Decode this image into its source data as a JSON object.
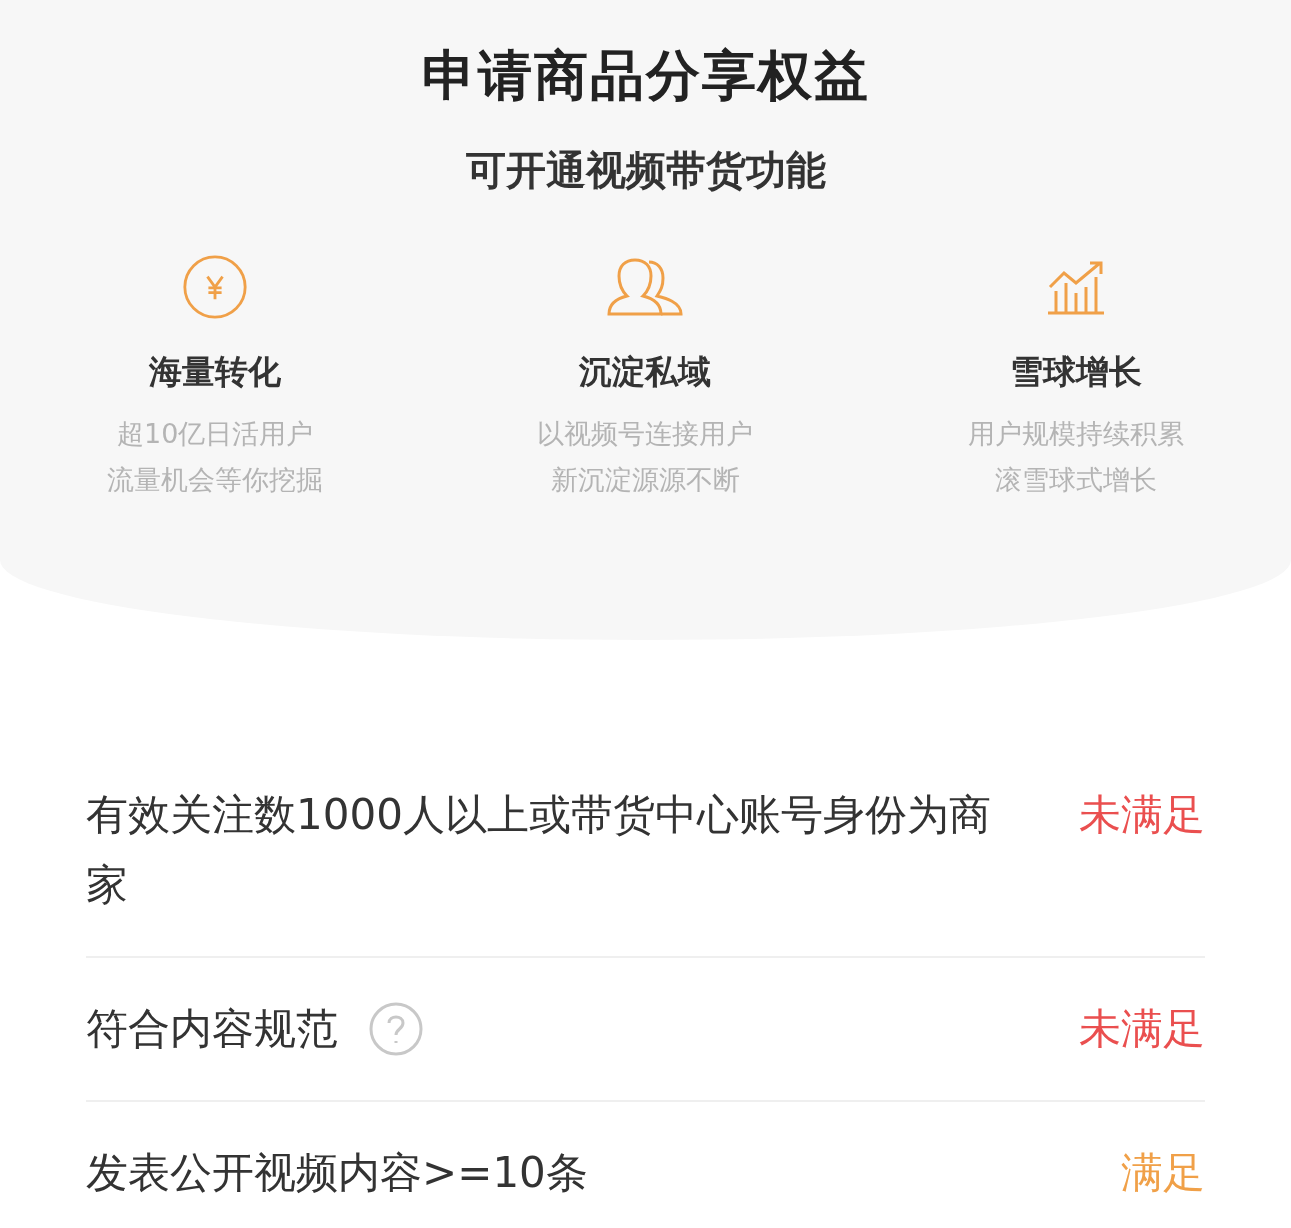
{
  "header": {
    "title": "申请商品分享权益",
    "subtitle": "可开通视频带货功能"
  },
  "features": [
    {
      "kind": "yen",
      "title": "海量转化",
      "lines": [
        "超10亿日活用户",
        "流量机会等你挖掘"
      ]
    },
    {
      "kind": "people",
      "title": "沉淀私域",
      "lines": [
        "以视频号连接用户",
        "新沉淀源源不断"
      ]
    },
    {
      "kind": "growth",
      "title": "雪球增长",
      "lines": [
        "用户规模持续积累",
        "滚雪球式增长"
      ]
    }
  ],
  "requirements": [
    {
      "text": "有效关注数1000人以上或带货中心账号身份为商家",
      "help": false,
      "met": false,
      "status": "未满足"
    },
    {
      "text": "符合内容规范",
      "help": true,
      "met": false,
      "status": "未满足"
    },
    {
      "text": "发表公开视频内容>=10条",
      "help": false,
      "met": true,
      "status": "满足"
    }
  ]
}
